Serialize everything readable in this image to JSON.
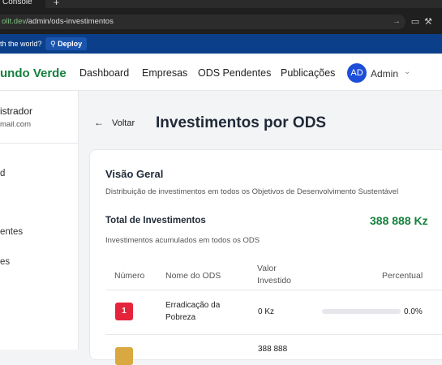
{
  "browser": {
    "tab_title": "Console",
    "url_host": "olit.dev",
    "url_path": "/admin/ods-investimentos"
  },
  "devbar": {
    "question": "th the world?",
    "deploy_label": "Deploy"
  },
  "nav": {
    "brand": "undo Verde",
    "links": [
      "Dashboard",
      "Empresas",
      "ODS Pendentes",
      "Publicações"
    ],
    "avatar_initials": "AD",
    "user_label": "Admin"
  },
  "sidebar": {
    "user_name": "istrador",
    "user_email": "mail.com",
    "items": [
      "d",
      "entes",
      "es"
    ]
  },
  "page": {
    "back_label": "Voltar",
    "title": "Investimentos por ODS"
  },
  "card": {
    "heading": "Visão Geral",
    "description": "Distribuição de investimentos em todos os Objetivos de Desenvolvimento Sustentável",
    "total_label": "Total de Investimentos",
    "total_value": "388 888 Kz",
    "total_sub": "Investimentos acumulados em todos os ODS"
  },
  "table": {
    "headers": {
      "numero": "Número",
      "nome": "Nome do ODS",
      "valor_line1": "Valor",
      "valor_line2": "Investido",
      "percentual": "Percentual"
    },
    "rows": [
      {
        "numero": "1",
        "badge_color": "#e5243b",
        "nome_line1": "Erradicação da",
        "nome_line2": "Pobreza",
        "valor": "0 Kz",
        "percentual_text": "0.0%",
        "percentual": 0
      },
      {
        "numero": "",
        "badge_color": "#d9a840",
        "nome_line1": "",
        "nome_line2": "",
        "valor": "388 888",
        "percentual_text": "",
        "percentual": null
      }
    ]
  }
}
